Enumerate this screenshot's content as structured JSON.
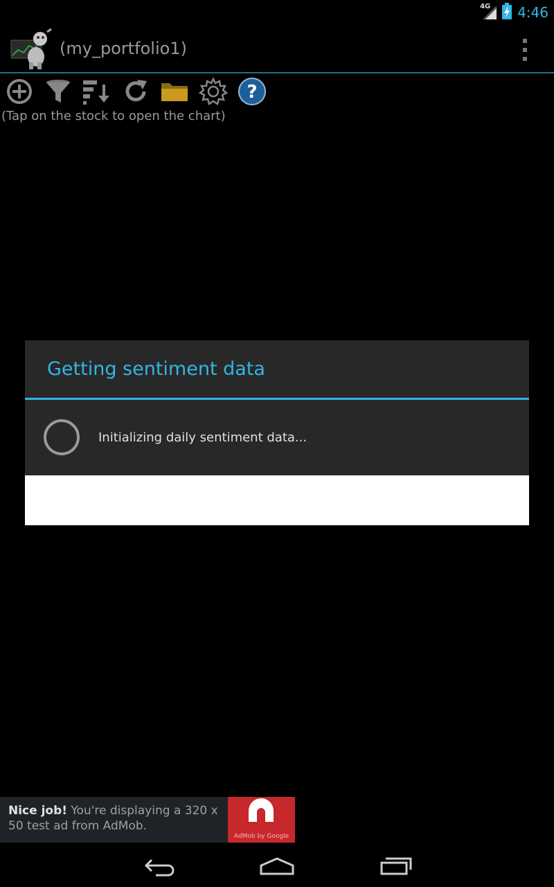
{
  "status_bar": {
    "network_label": "4G",
    "time": "4:46",
    "icons": [
      "signal-icon",
      "battery-charging-icon"
    ]
  },
  "action_bar": {
    "title": "(my_portfolio1)",
    "icons": [
      "app-logo-icon",
      "overflow-menu-icon"
    ]
  },
  "toolbar": {
    "icons": [
      "add-icon",
      "filter-icon",
      "sort-icon",
      "refresh-icon",
      "folder-icon",
      "settings-icon",
      "help-icon"
    ],
    "hint": "(Tap on the stock to open the chart)"
  },
  "dialog": {
    "title": "Getting sentiment data",
    "message": "Initializing daily sentiment data..."
  },
  "ad": {
    "bold": "Nice job!",
    "text": " You're displaying a 320 x 50 test ad from AdMob.",
    "logo_caption": "AdMob by Google"
  },
  "nav_bar": {
    "icons": [
      "back-icon",
      "home-icon",
      "recent-apps-icon"
    ]
  },
  "colors": {
    "accent": "#33b5e5",
    "folder": "#c89b1a",
    "help": "#1e5f9a",
    "ad_red": "#c6282b"
  }
}
